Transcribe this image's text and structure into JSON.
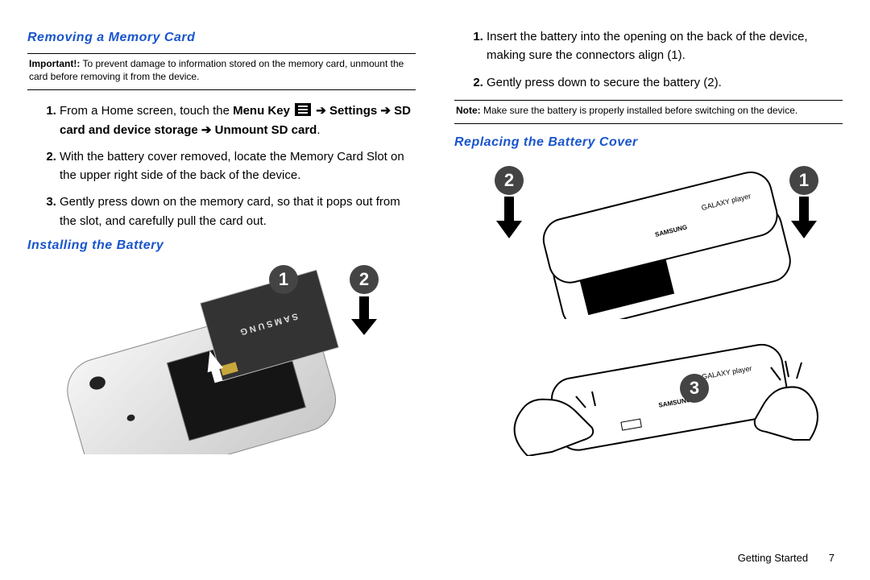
{
  "left": {
    "heading1": "Removing a Memory Card",
    "important": {
      "label": "Important!:",
      "text": " To prevent damage to information stored on the memory card, unmount the card before removing it from the device."
    },
    "steps_mem": {
      "s1_pre": "From a Home screen, touch the ",
      "s1_menu": "Menu Key",
      "s1_settings": "Settings",
      "s1_sd": "SD card and device storage",
      "s1_unmount": "Unmount SD card",
      "s2": "With the battery cover removed, locate the Memory Card Slot on the upper right side of the back of the device.",
      "s3": "Gently press down on the memory card, so that it pops out from the slot, and carefully pull the card out."
    },
    "heading2": "Installing the Battery",
    "bubbles": {
      "b1": "1",
      "b2": "2"
    }
  },
  "right": {
    "steps_install": {
      "s1": "Insert the battery into the opening on the back of the device, making sure the connectors align (1).",
      "s2": "Gently press down to secure the battery (2)."
    },
    "note": {
      "label": "Note:",
      "text": " Make sure the battery is properly installed before switching on the device."
    },
    "heading3": "Replacing the Battery Cover",
    "bubbles": {
      "b1": "1",
      "b2": "2",
      "b3": "3"
    }
  },
  "footer": {
    "section": "Getting Started",
    "page": "7"
  },
  "arrow_glyph": "➔"
}
